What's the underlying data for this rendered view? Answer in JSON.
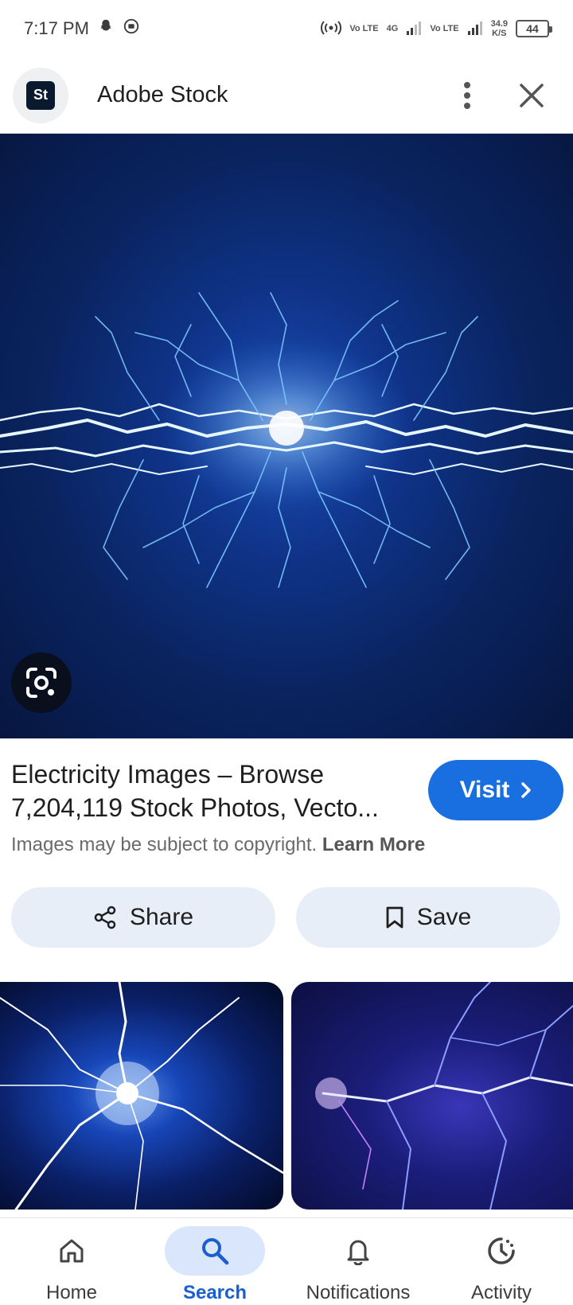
{
  "status_bar": {
    "time": "7:17 PM",
    "net_left": "Vo LTE",
    "net_4g": "4G",
    "net_right": "Vo LTE",
    "speed_value": "34.9",
    "speed_unit": "K/S",
    "battery": "44"
  },
  "header": {
    "logo_text": "St",
    "title": "Adobe Stock"
  },
  "result": {
    "title_line1": "Electricity Images – Browse",
    "title_line2": "7,204,119 Stock Photos, Vecto...",
    "visit_label": "Visit",
    "copyright_text": "Images may be subject to copyright.",
    "learn_more": "Learn More",
    "share_label": "Share",
    "save_label": "Save"
  },
  "bottom_nav": {
    "items": [
      {
        "label": "Home",
        "icon": "home-icon"
      },
      {
        "label": "Search",
        "icon": "search-icon",
        "active": true
      },
      {
        "label": "Notifications",
        "icon": "bell-icon"
      },
      {
        "label": "Activity",
        "icon": "activity-icon"
      }
    ]
  },
  "colors": {
    "accent": "#1a6fe0",
    "action_bg": "#e8eef8",
    "nav_active_bg": "#d9e6fb",
    "nav_active_text": "#1a5fd0"
  }
}
